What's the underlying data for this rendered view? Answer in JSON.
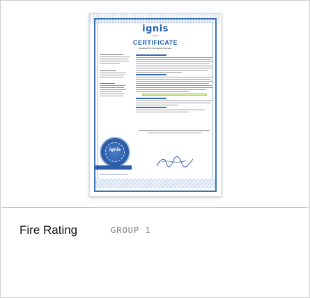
{
  "certificate": {
    "logo": "ignis",
    "logo_sub": "testing",
    "title": "CERTIFICATE",
    "subtitle": "Standard Fire Test Result Summary",
    "seal_text": "ignis",
    "accent_color": "#1f5fb2"
  },
  "property_row": {
    "label": "Fire Rating",
    "value": "GROUP 1"
  }
}
